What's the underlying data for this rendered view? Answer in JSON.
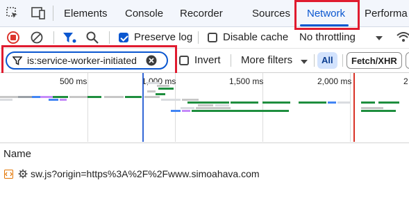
{
  "tabs": {
    "elements": "Elements",
    "console": "Console",
    "recorder": "Recorder",
    "sources": "Sources",
    "network": "Network",
    "performance": "Performa"
  },
  "toolbar": {
    "preserve_log_label": "Preserve log",
    "preserve_log_checked": true,
    "disable_cache_label": "Disable cache",
    "disable_cache_checked": false,
    "throttling_value": "No throttling"
  },
  "filter": {
    "value": "is:service-worker-initiated",
    "invert_label": "Invert",
    "more_filters_label": "More filters",
    "all_label": "All",
    "fetch_xhr_label": "Fetch/XHR"
  },
  "timeline": {
    "ticks": [
      "500 ms",
      "1,000 ms",
      "1,500 ms",
      "2,000 ms",
      "2"
    ]
  },
  "table": {
    "name_header": "Name",
    "rows": [
      {
        "name": "sw.js?origin=https%3A%2F%2Fwww.simoahava.com"
      }
    ]
  },
  "colors": {
    "accent": "#0b57d0",
    "highlight_red": "#e01b2f",
    "record_red": "#dc362e"
  }
}
